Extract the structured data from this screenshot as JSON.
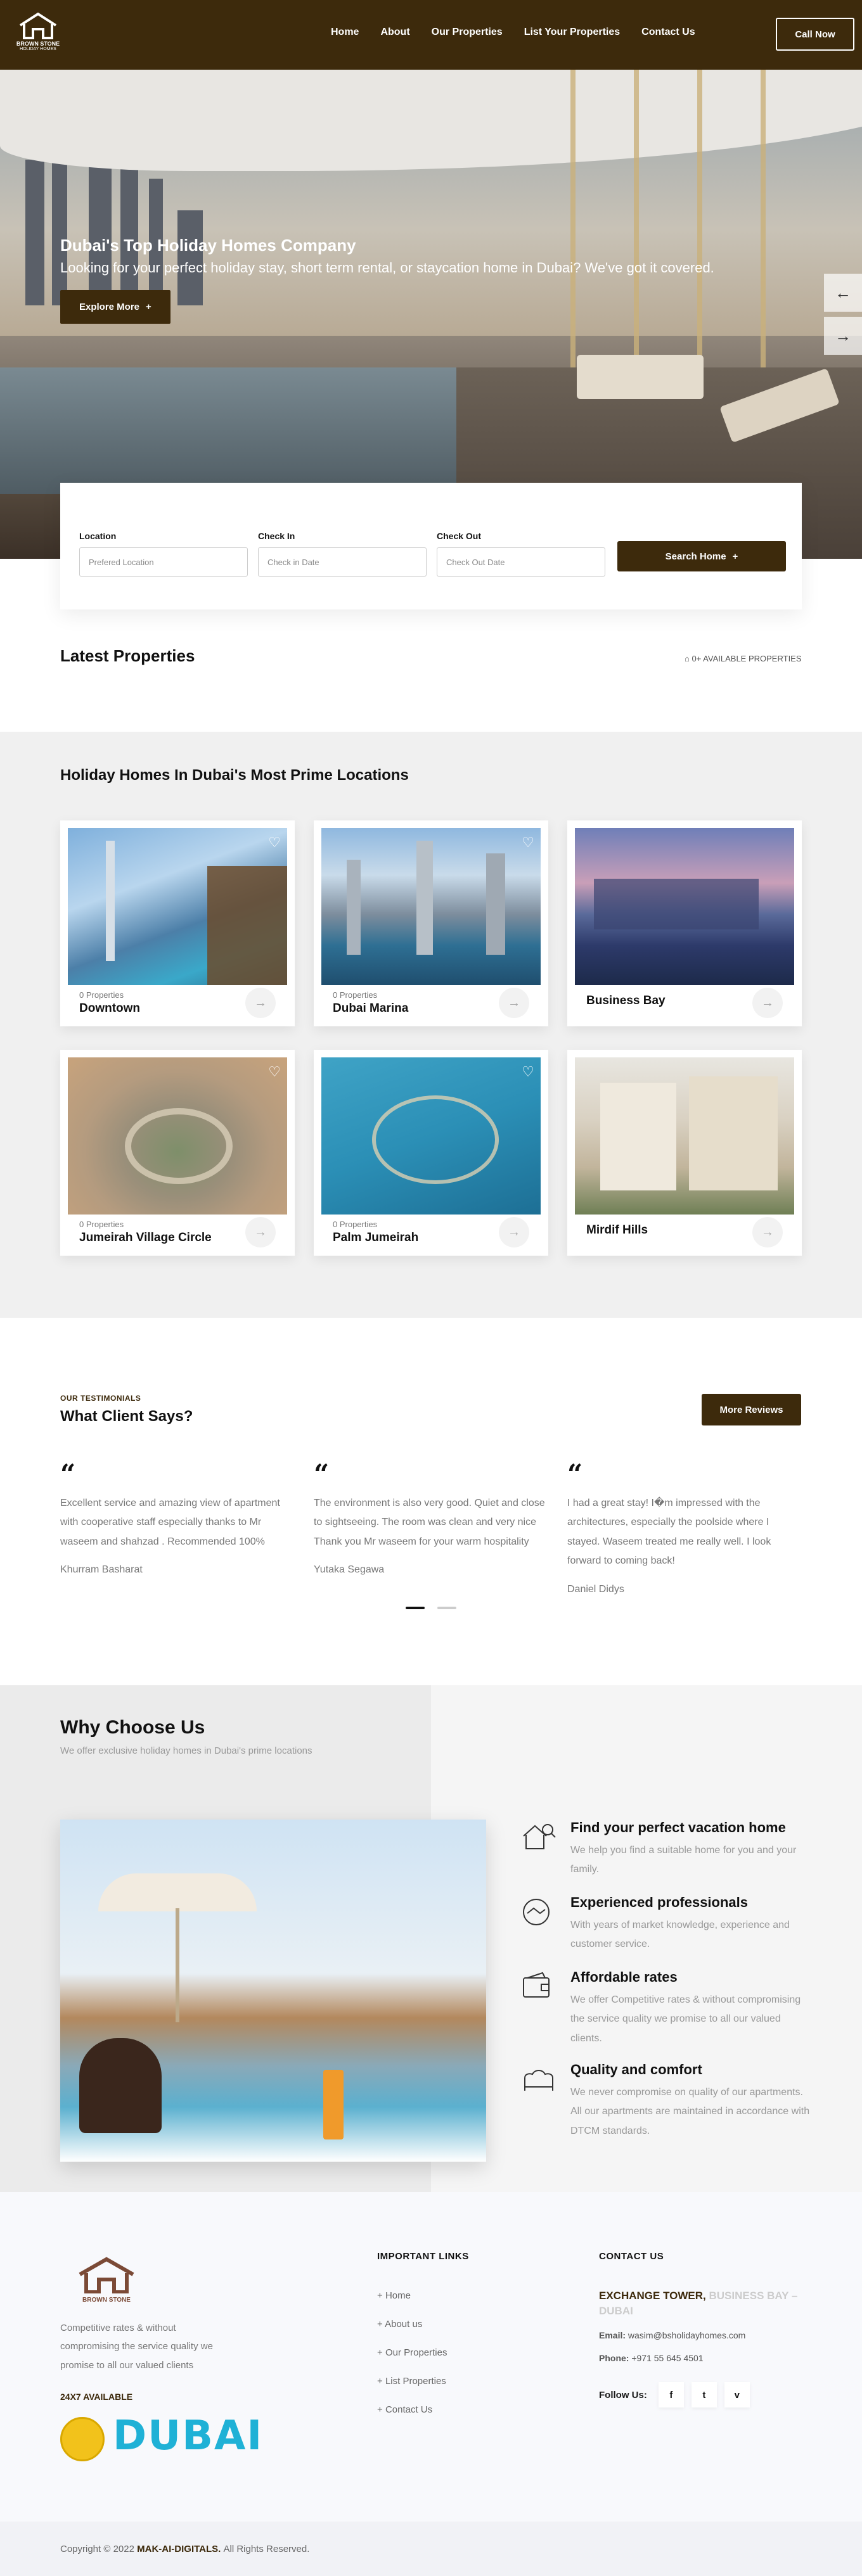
{
  "header": {
    "logo_text": "BROWN STONE",
    "logo_subtext": "HOLIDAY HOMES",
    "nav": [
      "Home",
      "About",
      "Our Properties",
      "List Your Properties",
      "Contact Us"
    ],
    "call_button": "Call Now"
  },
  "hero": {
    "title": "Dubai's Top Holiday Homes Company",
    "subtitle": "Looking for your perfect holiday stay, short term rental, or staycation home in Dubai? We've got it covered.",
    "cta": "Explore More",
    "prev_icon": "arrow-left-icon",
    "next_icon": "arrow-right-icon"
  },
  "search": {
    "location_label": "Location",
    "location_placeholder": "Prefered Location",
    "checkin_label": "Check In",
    "checkin_placeholder": "Check in Date",
    "checkout_label": "Check Out",
    "checkout_placeholder": "Check Out Date",
    "button": "Search Home"
  },
  "latest": {
    "title": "Latest Properties",
    "available": "0+ AVAILABLE PROPERTIES"
  },
  "locations": {
    "title": "Holiday Homes In Dubai's Most Prime Locations",
    "items": [
      {
        "count": "0 Properties",
        "name": "Downtown"
      },
      {
        "count": "0 Properties",
        "name": "Dubai Marina"
      },
      {
        "count": "",
        "name": "Business Bay"
      },
      {
        "count": "0 Properties",
        "name": "Jumeirah Village Circle"
      },
      {
        "count": "0 Properties",
        "name": "Palm Jumeirah"
      },
      {
        "count": "",
        "name": "Mirdif Hills"
      }
    ]
  },
  "testimonials": {
    "label": "OUR TESTIMONIALS",
    "title": "What Client Says?",
    "more": "More Reviews",
    "reviews": [
      {
        "text": "Excellent service and amazing view of apartment with cooperative staff especially thanks to Mr waseem and shahzad . Recommended 100%",
        "author": "Khurram Basharat"
      },
      {
        "text": "The environment is also very good. Quiet and close to sightseeing. The room was clean and very nice Thank you Mr waseem for your warm hospitality",
        "author": "Yutaka Segawa"
      },
      {
        "text": "I had a great stay! I�m impressed with the architectures, especially the poolside where I stayed. Waseem treated me really well. I look forward to coming back!",
        "author": "Daniel Didys"
      }
    ]
  },
  "why": {
    "title": "Why Choose Us",
    "subtitle": "We offer exclusive holiday homes in Dubai's prime locations",
    "features": [
      {
        "title": "Find your perfect vacation home",
        "text": "We help you find a suitable home for you and your family."
      },
      {
        "title": "Experienced professionals",
        "text": "With years of market knowledge, experience and customer service."
      },
      {
        "title": "Affordable rates",
        "text": "We offer Competitive rates & without compromising the service quality we promise to all our valued clients."
      },
      {
        "title": "Quality and comfort",
        "text": "We never compromise on quality of our apartments. All our apartments are maintained in accordance with DTCM standards."
      }
    ]
  },
  "footer": {
    "logo_text": "BROWN STONE",
    "about": "Competitive rates & without compromising the service quality we promise to all our valued clients",
    "available": "24X7 AVAILABLE",
    "dubai_logo": "DUBAI",
    "links_title": "IMPORTANT LINKS",
    "links": [
      "Home",
      "About us",
      "Our Properties",
      "List Properties",
      "Contact Us"
    ],
    "contact_title": "CONTACT US",
    "address_bold": "EXCHANGE TOWER,",
    "address_rest": "BUSINESS BAY – DUBAI",
    "email_label": "Email:",
    "email": "wasim@bsholidayhomes.com",
    "phone_label": "Phone:",
    "phone": "+971 55 645 4501",
    "follow": "Follow Us:",
    "social": [
      "f",
      "t",
      "v"
    ],
    "copyright_prefix": "Copyright © 2022",
    "copyright_brand": "MAK-AI-DIGITALS.",
    "copyright_suffix": "All Rights Reserved."
  },
  "colors": {
    "brand": "#3d2a0c",
    "muted": "#999999"
  }
}
